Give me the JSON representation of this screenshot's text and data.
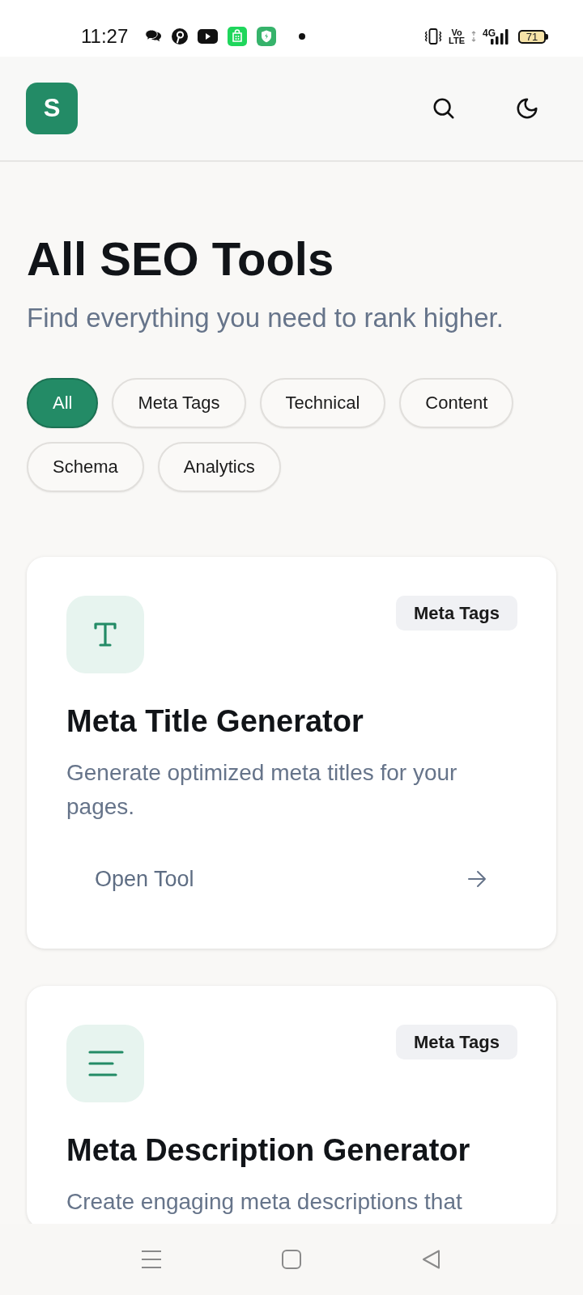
{
  "status_bar": {
    "time": "11:27",
    "volte": [
      "Vo",
      "LTE"
    ],
    "network": "4G",
    "battery": "71"
  },
  "header": {
    "logo": "S"
  },
  "page": {
    "title": "All SEO Tools",
    "subtitle": "Find everything you need to rank higher."
  },
  "filters": [
    {
      "label": "All",
      "selected": true
    },
    {
      "label": "Meta Tags",
      "selected": false
    },
    {
      "label": "Technical",
      "selected": false
    },
    {
      "label": "Content",
      "selected": false
    },
    {
      "label": "Schema",
      "selected": false
    },
    {
      "label": "Analytics",
      "selected": false
    }
  ],
  "tools": [
    {
      "kind": "title",
      "category": "Meta Tags",
      "name": "Meta Title Generator",
      "description": "Generate optimized meta titles for your pages.",
      "action": "Open Tool"
    },
    {
      "kind": "description",
      "category": "Meta Tags",
      "name": "Meta Description Generator",
      "description": "Create engaging meta descriptions that"
    }
  ]
}
